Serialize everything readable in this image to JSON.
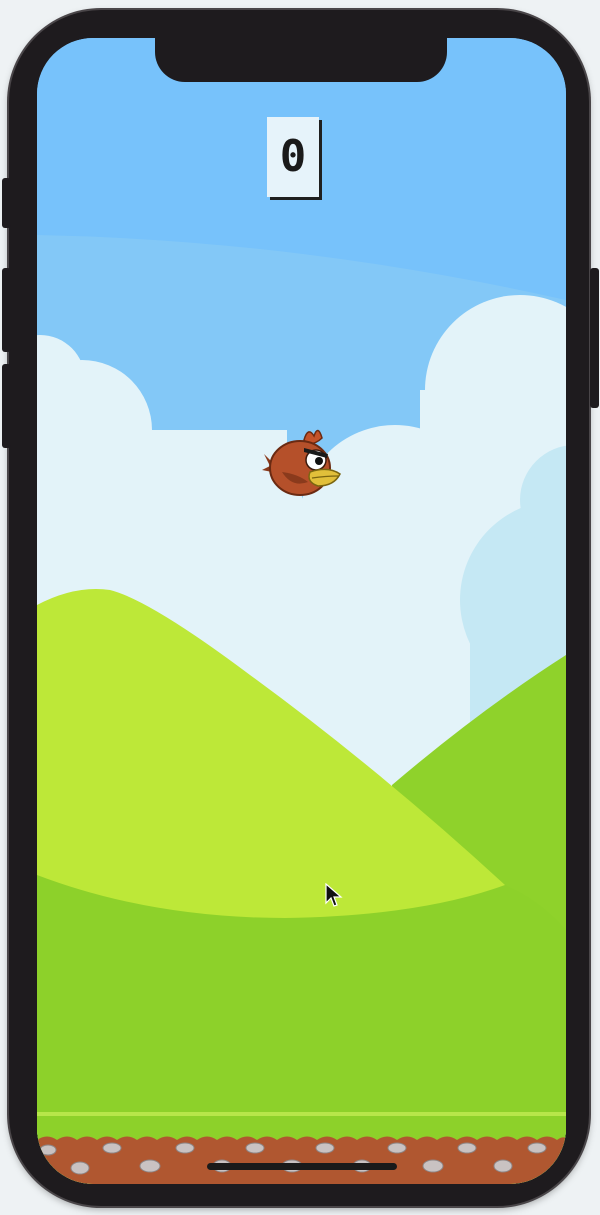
{
  "game": {
    "score": "0"
  },
  "palette": {
    "sky": "#77c2fb",
    "cloud": "#e3f3f9",
    "cloud_back": "#b6e1f1",
    "hill_front": "#bde838",
    "hill_back": "#8fd22b",
    "grass": "#8dd12a",
    "dirt": "#b05730",
    "device": "#1e1b1e"
  },
  "sprites": {
    "player": "red-bird-icon",
    "cursor": "mouse-pointer-icon"
  }
}
